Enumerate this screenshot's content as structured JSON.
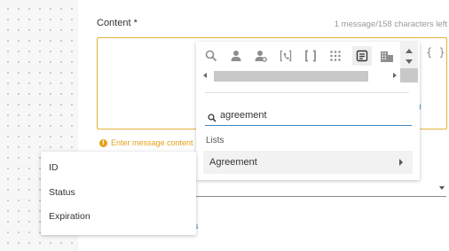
{
  "content": {
    "label": "Content",
    "required_mark": "*",
    "char_count": "1 message/158 characters left",
    "braces": "{ }"
  },
  "warning": {
    "text": "Enter message content",
    "icon": "exclamation-circle-icon",
    "color": "#e3a21a"
  },
  "picker": {
    "toolbar_icons": [
      "search-icon",
      "person-icon",
      "person-gear-icon",
      "phone-bracket-icon",
      "brackets-icon",
      "grid-dots-icon",
      "document-list-icon",
      "building-icon"
    ],
    "active_icon": "document-list-icon",
    "search": {
      "value": "agreement",
      "icon": "search-icon"
    },
    "section_label": "Lists",
    "items": [
      {
        "label": "Agreement"
      }
    ]
  },
  "submenu": {
    "items": [
      {
        "label": "ID"
      },
      {
        "label": "Status"
      },
      {
        "label": "Expiration"
      }
    ]
  },
  "colors": {
    "accent_border": "#e4b33a",
    "search_underline": "#3f87c2"
  }
}
